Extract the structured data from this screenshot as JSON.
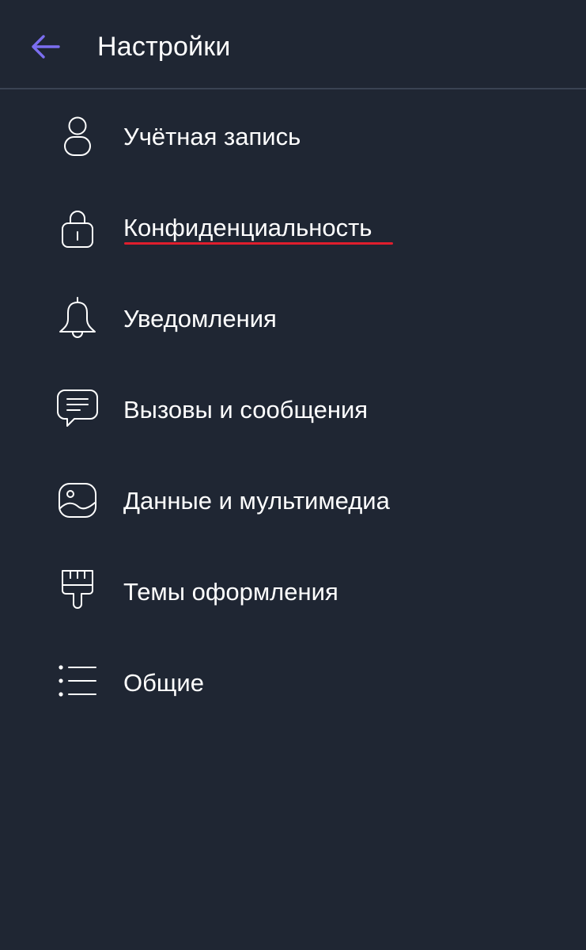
{
  "header": {
    "title": "Настройки",
    "back_icon": "arrow-left-icon",
    "back_icon_color": "#7b6ef0"
  },
  "menu": {
    "items": [
      {
        "label": "Учётная запись",
        "icon": "user-icon"
      },
      {
        "label": "Конфиденциальность",
        "icon": "lock-icon"
      },
      {
        "label": "Уведомления",
        "icon": "bell-icon"
      },
      {
        "label": "Вызовы и сообщения",
        "icon": "chat-icon"
      },
      {
        "label": "Данные и мультимедиа",
        "icon": "image-icon"
      },
      {
        "label": "Темы оформления",
        "icon": "brush-icon"
      },
      {
        "label": "Общие",
        "icon": "list-icon"
      }
    ]
  },
  "colors": {
    "background": "#1f2633",
    "divider": "#3a4353",
    "text": "#ffffff",
    "accent": "#7b6ef0",
    "highlight_underline": "#e01e2d"
  }
}
